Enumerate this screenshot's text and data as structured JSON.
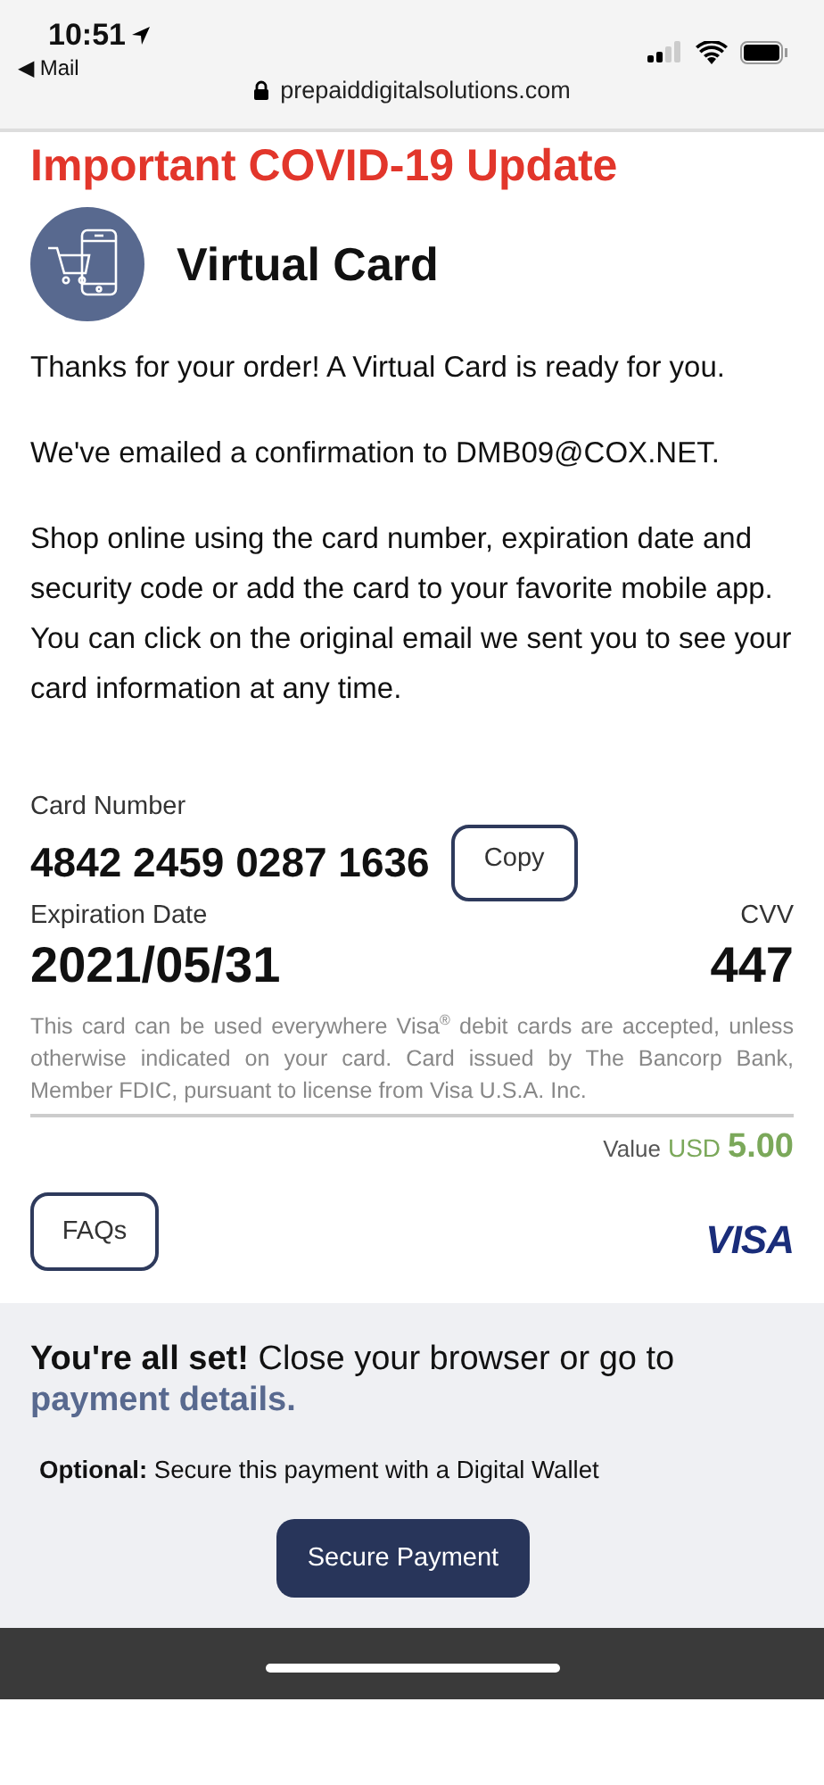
{
  "status_bar": {
    "time": "10:51",
    "back_app": "◀ Mail"
  },
  "browser": {
    "url": "prepaiddigitalsolutions.com"
  },
  "alert": {
    "text": "Important COVID-19 Update"
  },
  "header": {
    "title": "Virtual Card"
  },
  "paragraphs": [
    "Thanks for your order! A Virtual Card is ready for you.",
    "We've emailed a confirmation to DMB09@COX.NET.",
    "Shop online using the card number, expiration date and security code or add the card to your favorite mobile app. You can click on the original email we sent you to see your card information at any time."
  ],
  "card": {
    "number_label": "Card Number",
    "number": "4842 2459 0287 1636",
    "copy_button": "Copy",
    "expiration_label": "Expiration Date",
    "expiration": "2021/05/31",
    "cvv_label": "CVV",
    "cvv": "447",
    "disclaimer": "This card can be used everywhere Visa$^{®}$ debit cards are accepted, unless otherwise indicated on your card. Card issued by The Bancorp Bank, Member FDIC, pursuant to license from Visa U.S.A. Inc.",
    "value_label": "Value",
    "currency": "USD",
    "amount": "5.00"
  },
  "faqs_button": "FAQs",
  "brand": "VISA",
  "footer": {
    "message": "**You're all set!** Close your browser or go to",
    "link": "payment details.",
    "optional": "**Optional:** Secure this payment with a Digital Wallet",
    "button": "Secure Payment"
  }
}
